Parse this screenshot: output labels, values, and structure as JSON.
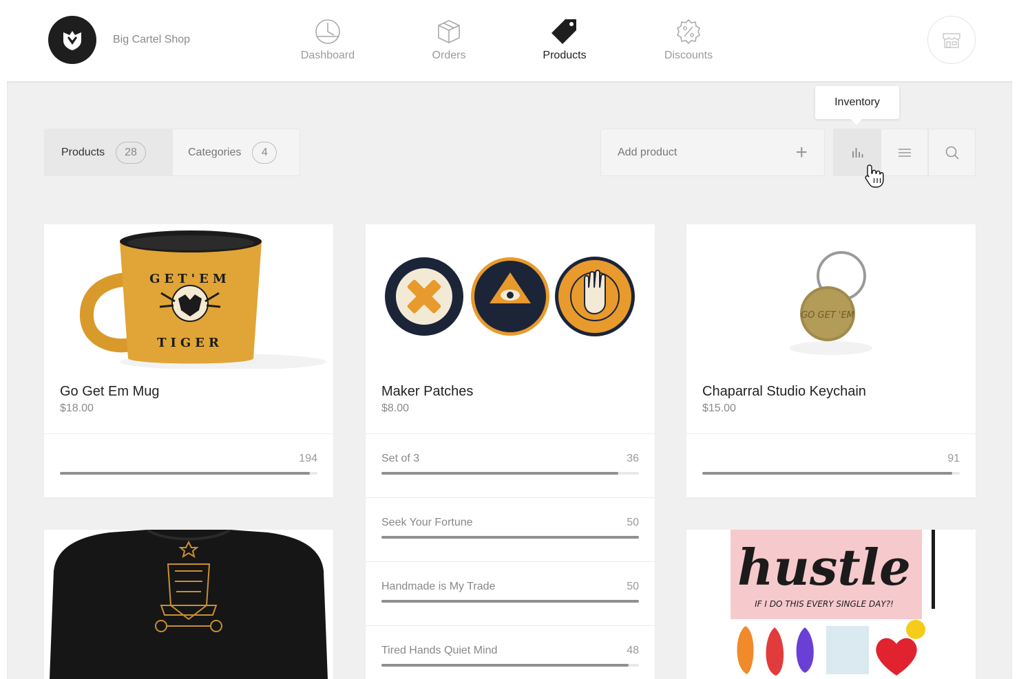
{
  "header": {
    "shop_name": "Big Cartel Shop",
    "nav": [
      {
        "label": "Dashboard",
        "icon": "dashboard-icon",
        "active": false
      },
      {
        "label": "Orders",
        "icon": "box-icon",
        "active": false
      },
      {
        "label": "Products",
        "icon": "tag-icon",
        "active": true
      },
      {
        "label": "Discounts",
        "icon": "percent-badge-icon",
        "active": false
      }
    ],
    "store_icon": "storefront-icon"
  },
  "toolbar": {
    "products_label": "Products",
    "products_count": "28",
    "categories_label": "Categories",
    "categories_count": "4",
    "add_product_label": "Add product",
    "tooltip": "Inventory"
  },
  "products": [
    {
      "name": "Go Get Em Mug",
      "price": "$18.00",
      "inventory": [
        {
          "label": "",
          "count": "194",
          "fill": 0.97
        }
      ]
    },
    {
      "name": "Maker Patches",
      "price": "$8.00",
      "inventory": [
        {
          "label": "Set of 3",
          "count": "36",
          "fill": 0.92
        },
        {
          "label": "Seek Your Fortune",
          "count": "50",
          "fill": 1.0
        },
        {
          "label": "Handmade is My Trade",
          "count": "50",
          "fill": 1.0
        },
        {
          "label": "Tired Hands Quiet Mind",
          "count": "48",
          "fill": 0.96
        }
      ]
    },
    {
      "name": "Chaparral Studio Keychain",
      "price": "$15.00",
      "inventory": [
        {
          "label": "",
          "count": "91",
          "fill": 0.97
        }
      ]
    }
  ],
  "image_text": {
    "mug_top": "GET'EM",
    "mug_bottom": "TIGER",
    "keychain": "GO GET 'EM",
    "poster_main": "hustle",
    "poster_sub": "IF I DO THIS EVERY SINGLE DAY?!"
  },
  "colors": {
    "accent_dark": "#1e1e1e",
    "mug_yellow": "#e0a536",
    "patch_navy": "#1c2438",
    "patch_orange": "#e89a2c"
  }
}
